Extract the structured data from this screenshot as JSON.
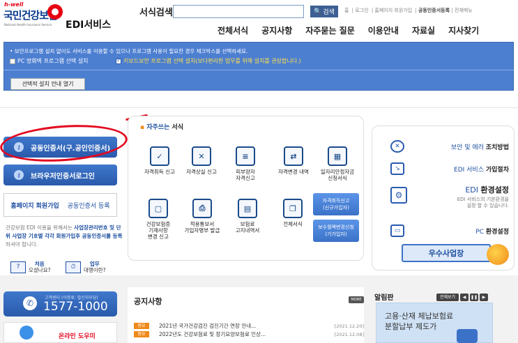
{
  "header": {
    "logo_small": "h-well",
    "logo_name": "국민건강보험",
    "logo_eng": "National Health Insurance Service",
    "logo_service": "EDI서비스",
    "search_label": "서식검색",
    "search_placeholder": "",
    "search_button": "검색",
    "top_links": [
      "홈",
      "로그인",
      "홈페이지 회원가입",
      "공동인증서등록",
      "전체메뉴"
    ],
    "gnb": [
      "전체서식",
      "공지사항",
      "자주묻는 질문",
      "이용안내",
      "자료실",
      "지사찾기"
    ]
  },
  "security_bar": {
    "note": "• 보안프로그램 설치 없이도 서비스를 이용할 수 있으나 프로그램 사용이 필요한 경우 체크박스를 선택하세요.",
    "option_pc": "PC 방화벽 프로그램 선택 설치",
    "option_keyboard": "키보드보안 프로그램 선택 설치(보다편리한 업무를 위해 설치를 권장합니다.)",
    "guide_button": "선택적 설치 안내 열기"
  },
  "login": {
    "cert_button": "공동인증서(구.공인인증서)",
    "browser_button": "브라우저인증서로그인",
    "join_label": "홈페이지 회원가입",
    "cert_register": "공동인증서 등록",
    "note_pre": "건강보험 EDI 이용을 위해서는 ",
    "note_bold": "사업장관리번호 및 단위 사업장 기호별 각각 회원가입후 공동인증서를 등록",
    "note_post": "하셔야 합니다.",
    "first_label_1": "처음",
    "first_label_2": "오셨나요?",
    "work_label_1": "업무",
    "work_label_2": "대행이란?"
  },
  "frequent": {
    "title_blue": "자주쓰는",
    "title_black": " 서식",
    "items": [
      {
        "icon": "document-check-icon",
        "label": "자격취득 신고"
      },
      {
        "icon": "document-cross-icon",
        "label": "자격상실 신고"
      },
      {
        "icon": "document-dependent-icon",
        "label": "피부양자\n자격신고"
      },
      {
        "icon": "monitor-change-icon",
        "label": "자격변경 내역"
      },
      {
        "icon": "calendar-support-icon",
        "label": "일자리안정자금\n신청서식"
      },
      {
        "icon": "phone-registry-icon",
        "label": "건강보험증\n기재사항\n변경 신고"
      },
      {
        "icon": "printer-icon",
        "label": "적용통보서\n가입자명부 발급"
      },
      {
        "icon": "calculator-icon",
        "label": "보험료\n고지내역서"
      },
      {
        "icon": "documents-icon",
        "label": "전체서식"
      }
    ],
    "pill_1_l1": "자격취득신고",
    "pill_1_l2": "(신규가입자)",
    "pill_2_l1": "보수월액변경신청",
    "pill_2_l2": "(기가입자)"
  },
  "right_panel": {
    "rows": [
      {
        "icon": "error-x-icon",
        "blue": "보안 및 에러",
        "black": "조치방법"
      },
      {
        "icon": "monitor-arrow-icon",
        "blue": "EDI 서비스",
        "black": "가입절차"
      },
      {
        "icon": "gear-folder-icon",
        "blue": "EDI",
        "black": "환경설정",
        "sub": "EDI 서비스의 기본환경을\n설정 할 수 있습니다."
      },
      {
        "icon": "pc-settings-icon",
        "blue": "PC",
        "black": "환경설정"
      }
    ],
    "best_button": "우수사업장"
  },
  "bottom": {
    "cc_sub": "고객센터 (이용료: 발신자부담)",
    "cc_number": "1577-1000",
    "helper": "온라인 도우미",
    "notice_title": "공지사항",
    "more": "MORE",
    "notices": [
      {
        "tag": "중요",
        "title": "2021년 국가건강검진 검진기간 연장 안내...",
        "date": "[2021.12.20]"
      },
      {
        "tag": "중요",
        "title": "2022년도 건강보험료 및 장기요양보험료 인상...",
        "date": "[2021.12.08]"
      }
    ],
    "alarm_title": "알림판",
    "alarm_all": "전체보기",
    "alarm_text": "고용·산재 체납보험료 분할납부 제도가"
  },
  "colors": {
    "brand_blue": "#1e4fa1",
    "bar_blue": "#4d7fd1",
    "highlight_red": "#e3081f",
    "accent_orange": "#f08a1a"
  }
}
